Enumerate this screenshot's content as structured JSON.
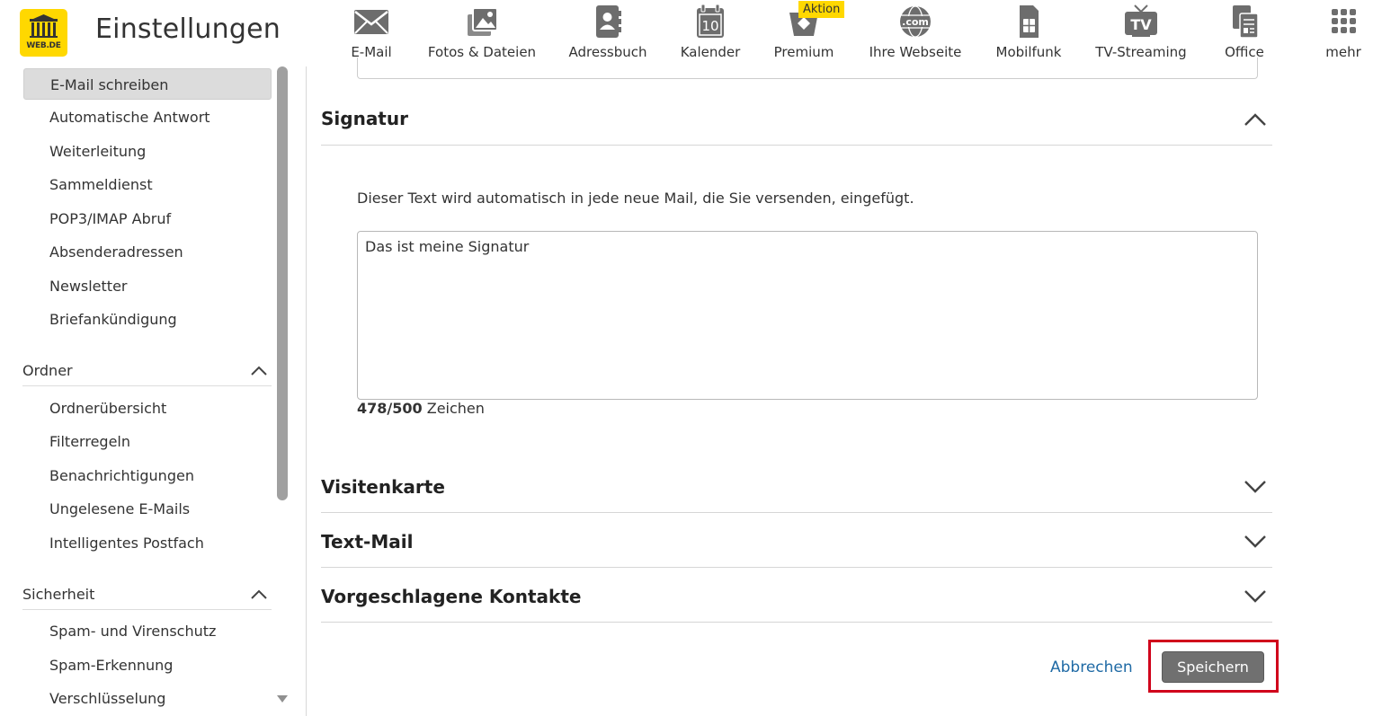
{
  "header": {
    "logo_text": "WEB.DE",
    "title": "Einstellungen",
    "nav": [
      {
        "label": "E-Mail",
        "icon": "envelope-icon"
      },
      {
        "label": "Fotos & Dateien",
        "icon": "photos-icon"
      },
      {
        "label": "Adressbuch",
        "icon": "address-book-icon"
      },
      {
        "label": "Kalender",
        "icon": "calendar-icon"
      },
      {
        "label": "Premium",
        "icon": "premium-icon"
      },
      {
        "label": "Ihre Webseite",
        "icon": "globe-com-icon"
      },
      {
        "label": "Mobilfunk",
        "icon": "sim-card-icon"
      },
      {
        "label": "TV-Streaming",
        "icon": "tv-icon"
      },
      {
        "label": "Office",
        "icon": "office-icon"
      },
      {
        "label": "mehr",
        "icon": "apps-grid-icon"
      }
    ],
    "calendar_day": "10",
    "globe_text": ".com",
    "tv_text": "TV",
    "premium_badge": "Aktion"
  },
  "sidebar": {
    "mail_items": [
      "E-Mail schreiben",
      "Automatische Antwort",
      "Weiterleitung",
      "Sammeldienst",
      "POP3/IMAP Abruf",
      "Absenderadressen",
      "Newsletter",
      "Briefankündigung"
    ],
    "active_item": "E-Mail schreiben",
    "ordner": {
      "title": "Ordner",
      "items": [
        "Ordnerübersicht",
        "Filterregeln",
        "Benachrichtigungen",
        "Ungelesene E-Mails",
        "Intelligentes Postfach"
      ]
    },
    "sicherheit": {
      "title": "Sicherheit",
      "items": [
        "Spam- und Virenschutz",
        "Spam-Erkennung",
        "Verschlüsselung"
      ]
    }
  },
  "main": {
    "signatur": {
      "title": "Signatur",
      "description": "Dieser Text wird automatisch in jede neue Mail, die Sie versenden, eingefügt.",
      "text": "Das ist meine Signatur",
      "count": "478/500",
      "count_unit": "Zeichen"
    },
    "sections": [
      "Visitenkarte",
      "Text-Mail",
      "Vorgeschlagene Kontakte"
    ],
    "cancel_label": "Abbrechen",
    "save_label": "Speichern"
  },
  "colors": {
    "brand_yellow": "#ffd800",
    "link_blue": "#1f6aa5",
    "save_button": "#707070",
    "highlight_red": "#d0021b"
  }
}
